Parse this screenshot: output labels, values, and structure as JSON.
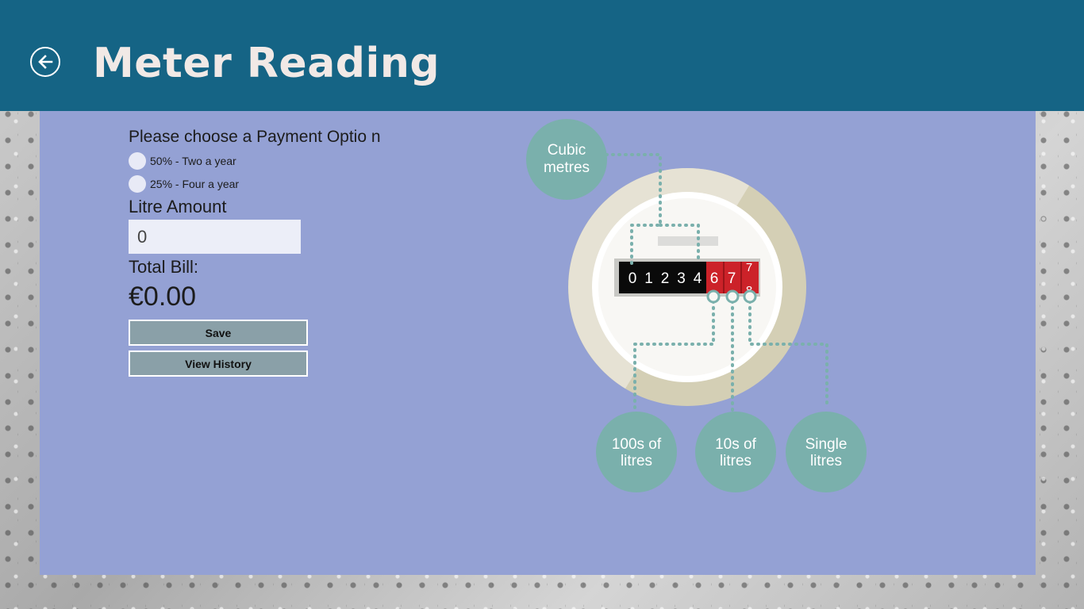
{
  "header": {
    "title": "Meter Reading",
    "back_icon": "back-arrow-icon"
  },
  "form": {
    "payment_prompt": "Please choose a Payment Optio n",
    "payment_options": [
      {
        "label": "50% - Two a year",
        "selected": false
      },
      {
        "label": "25% - Four a year",
        "selected": false
      }
    ],
    "litre_label": "Litre Amount",
    "litre_value": "0",
    "total_label": "Total Bill:",
    "total_value": "€0.00",
    "save_label": "Save",
    "history_label": "View History"
  },
  "meter": {
    "digits_black": [
      "0",
      "1",
      "2",
      "3",
      "4"
    ],
    "digits_red": [
      "6",
      "7"
    ],
    "digits_partial": [
      "7",
      "8"
    ],
    "bubbles": {
      "cubic": [
        "Cubic",
        "metres"
      ],
      "hundreds": [
        "100s of",
        "litres"
      ],
      "tens": [
        "10s of",
        "litres"
      ],
      "single": [
        "Single",
        "litres"
      ]
    }
  },
  "colors": {
    "header": "#156485",
    "panel": "#94a1d4",
    "bubble": "#7ab0ac",
    "counter_red": "#cc2229"
  }
}
